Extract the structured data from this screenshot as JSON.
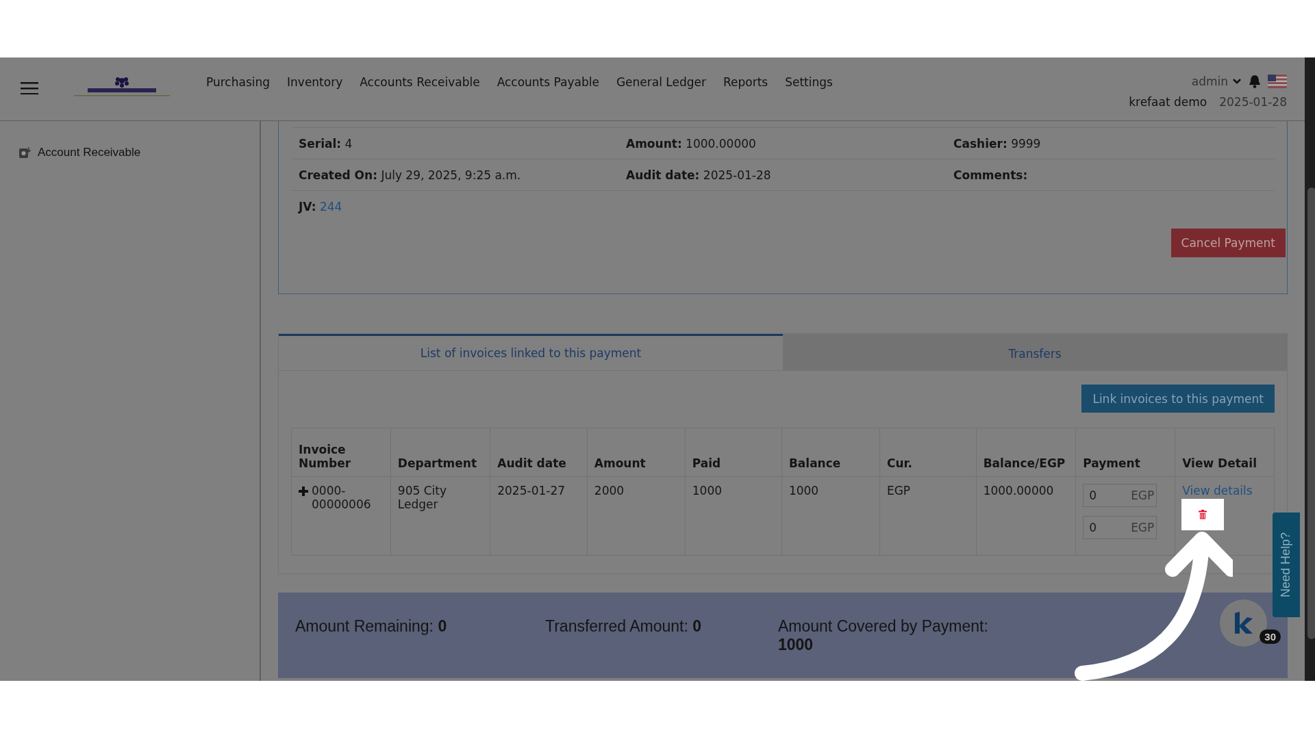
{
  "header": {
    "nav": [
      "Purchasing",
      "Inventory",
      "Accounts Receivable",
      "Accounts Payable",
      "General Ledger",
      "Reports",
      "Settings"
    ],
    "user": "admin",
    "company": "krefaat demo",
    "date": "2025-01-28"
  },
  "sidebar": {
    "items": [
      {
        "label": "Account Receivable"
      }
    ]
  },
  "details": {
    "rows": [
      [
        {
          "label": "Serial:",
          "value": "4",
          "kind": "text"
        },
        {
          "label": "Amount:",
          "value": "1000.00000",
          "kind": "text"
        },
        {
          "label": "Cashier:",
          "value": "9999",
          "kind": "text"
        }
      ],
      [
        {
          "label": "Created On:",
          "value": "July 29, 2025, 9:25 a.m.",
          "kind": "text"
        },
        {
          "label": "Audit date:",
          "value": "2025-01-28",
          "kind": "text"
        },
        {
          "label": "Comments:",
          "kind": "text"
        }
      ],
      [
        {
          "label": "JV:",
          "value": "244",
          "kind": "link"
        }
      ]
    ],
    "cancel_button": "Cancel Payment"
  },
  "tabs": [
    {
      "label": "List of invoices linked to this payment",
      "selected": true
    },
    {
      "label": "Transfers",
      "selected": false
    }
  ],
  "link_button": "Link invoices to this payment",
  "table": {
    "columns": [
      "Invoice Number",
      "Department",
      "Audit date",
      "Amount",
      "Paid",
      "Balance",
      "Cur.",
      "Balance/EGP",
      "Payment",
      "View Detail"
    ],
    "rows": [
      {
        "cells": [
          "0000-00000006",
          "905 City Ledger",
          "2025-01-27",
          "2000",
          "1000",
          "1000",
          "EGP",
          "1000.00000"
        ],
        "payments": [
          {
            "value": "0",
            "currency": "EGP"
          },
          {
            "value": "0",
            "currency": "EGP"
          }
        ],
        "view_link": "View details"
      }
    ]
  },
  "summary": [
    {
      "label": "Amount Remaining:",
      "value": "0"
    },
    {
      "label": "Transferred Amount:",
      "value": "0"
    },
    {
      "label": "Amount Covered by Payment:",
      "value": "1000"
    }
  ],
  "help_tab": "Need Help?",
  "chat_badge": "30"
}
